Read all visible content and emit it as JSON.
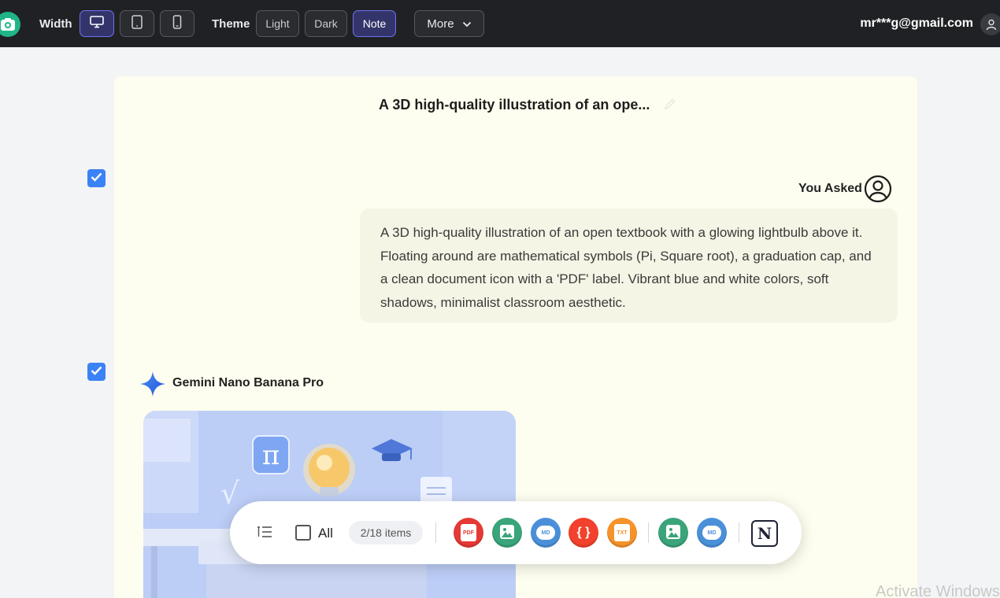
{
  "topbar": {
    "width_label": "Width",
    "width_options": [
      {
        "icon": "desktop-icon",
        "active": true
      },
      {
        "icon": "tablet-icon",
        "active": false
      },
      {
        "icon": "phone-icon",
        "active": false
      }
    ],
    "theme_label": "Theme",
    "theme_options": [
      "Light",
      "Dark",
      "Note"
    ],
    "theme_selected": "Note",
    "more_label": "More",
    "user_email": "mr***g@gmail.com"
  },
  "document": {
    "title": "A 3D high-quality illustration of an ope...",
    "user_turn": {
      "label": "You Asked",
      "text": "A 3D high-quality illustration of an open textbook with a glowing lightbulb above it. Floating around are mathematical symbols (Pi, Square root), a graduation cap, and a clean document icon with a 'PDF' label. Vibrant blue and white colors, soft shadows, minimalist classroom aesthetic."
    },
    "model_turn": {
      "name": "Gemini Nano Banana Pro",
      "image_symbols": {
        "pi": "π",
        "sqrt": "√"
      }
    }
  },
  "export_bar": {
    "all_label": "All",
    "count_label": "2/18 items",
    "formats": [
      {
        "icon": "pdf-icon",
        "label": "PDF",
        "color": "#e53935"
      },
      {
        "icon": "image-icon",
        "label": "",
        "color": "#3aa47a"
      },
      {
        "icon": "markdown-icon",
        "label": "MD",
        "color": "#4a90d9"
      },
      {
        "icon": "json-icon",
        "label": "{ }",
        "color": "#f2412c"
      },
      {
        "icon": "txt-icon",
        "label": "TXT",
        "color": "#f5932a"
      },
      {
        "icon": "image-icon",
        "label": "",
        "color": "#3aa47a"
      },
      {
        "icon": "markdown-icon",
        "label": "MD",
        "color": "#4a90d9"
      }
    ],
    "notion_label": "N"
  },
  "watermark": "Activate Windows",
  "colors": {
    "topbar_bg": "#202124",
    "accent": "#6d74f0",
    "card_bg": "#fefef0",
    "checkbox": "#3b82f6"
  }
}
